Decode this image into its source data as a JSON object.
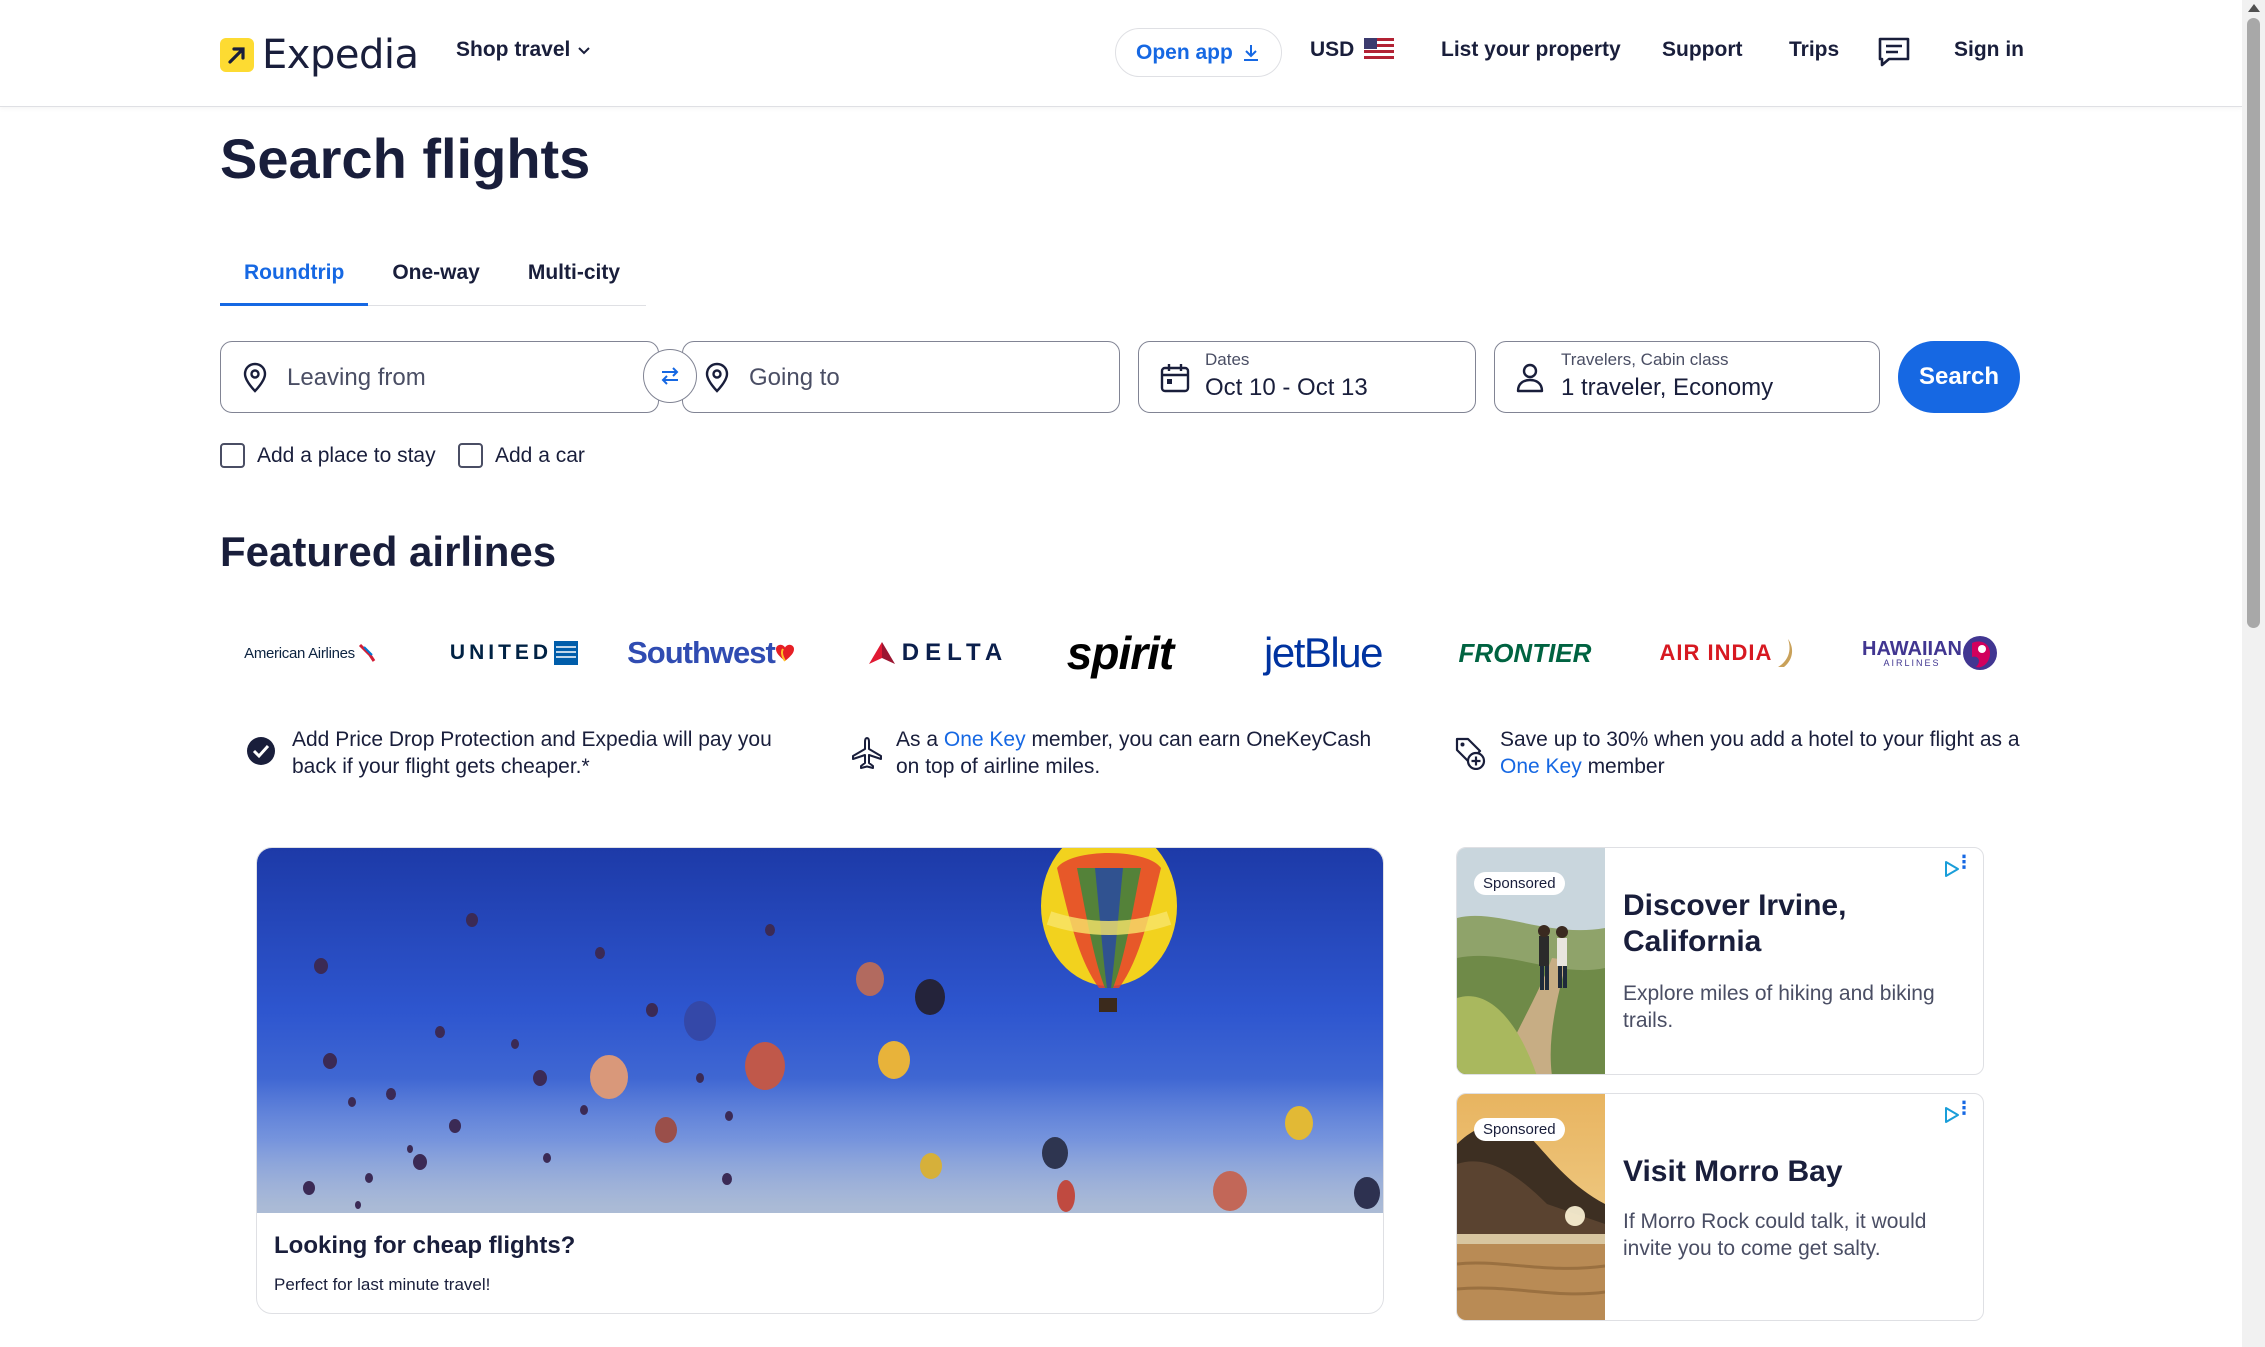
{
  "header": {
    "logo_text": "Expedia",
    "shop_travel": "Shop travel",
    "open_app": "Open app",
    "currency": "USD",
    "list_property": "List your property",
    "support": "Support",
    "trips": "Trips",
    "sign_in": "Sign in"
  },
  "page_title": "Search flights",
  "tabs": [
    {
      "label": "Roundtrip",
      "active": true
    },
    {
      "label": "One-way",
      "active": false
    },
    {
      "label": "Multi-city",
      "active": false
    }
  ],
  "search": {
    "leaving_placeholder": "Leaving from",
    "going_placeholder": "Going to",
    "dates_label": "Dates",
    "dates_value": "Oct 10 - Oct 13",
    "travelers_label": "Travelers, Cabin class",
    "travelers_value": "1 traveler, Economy",
    "search_button": "Search",
    "add_stay": "Add a place to stay",
    "add_car": "Add a car"
  },
  "featured": {
    "title": "Featured airlines",
    "airlines": [
      "American Airlines",
      "UNITED",
      "Southwest",
      "DELTA",
      "spirit",
      "jetBlue",
      "FRONTIER",
      "AIR INDIA",
      "HAWAIIAN",
      "AIRLINES"
    ]
  },
  "benefits": {
    "b1": "Add Price Drop Protection and Expedia will pay you back if your flight gets cheaper.*",
    "b2_pre": "As a",
    "b2_link": "One Key",
    "b2_post": "member, you can earn OneKeyCash on top of airline miles.",
    "b3_pre": "Save up to 30% when you add a hotel to your flight as a",
    "b3_link": "One Key",
    "b3_post": "member"
  },
  "promo": {
    "title": "Looking for cheap flights?",
    "subtitle": "Perfect for last minute travel!"
  },
  "ads": [
    {
      "badge": "Sponsored",
      "title": "Discover Irvine, California",
      "text": "Explore miles of hiking and biking trails."
    },
    {
      "badge": "Sponsored",
      "title": "Visit Morro Bay",
      "text": "If Morro Rock could talk, it would invite you to come get salty."
    }
  ],
  "colors": {
    "primary": "#1668e3",
    "text": "#191e3b",
    "logo_yellow": "#fddb32"
  }
}
